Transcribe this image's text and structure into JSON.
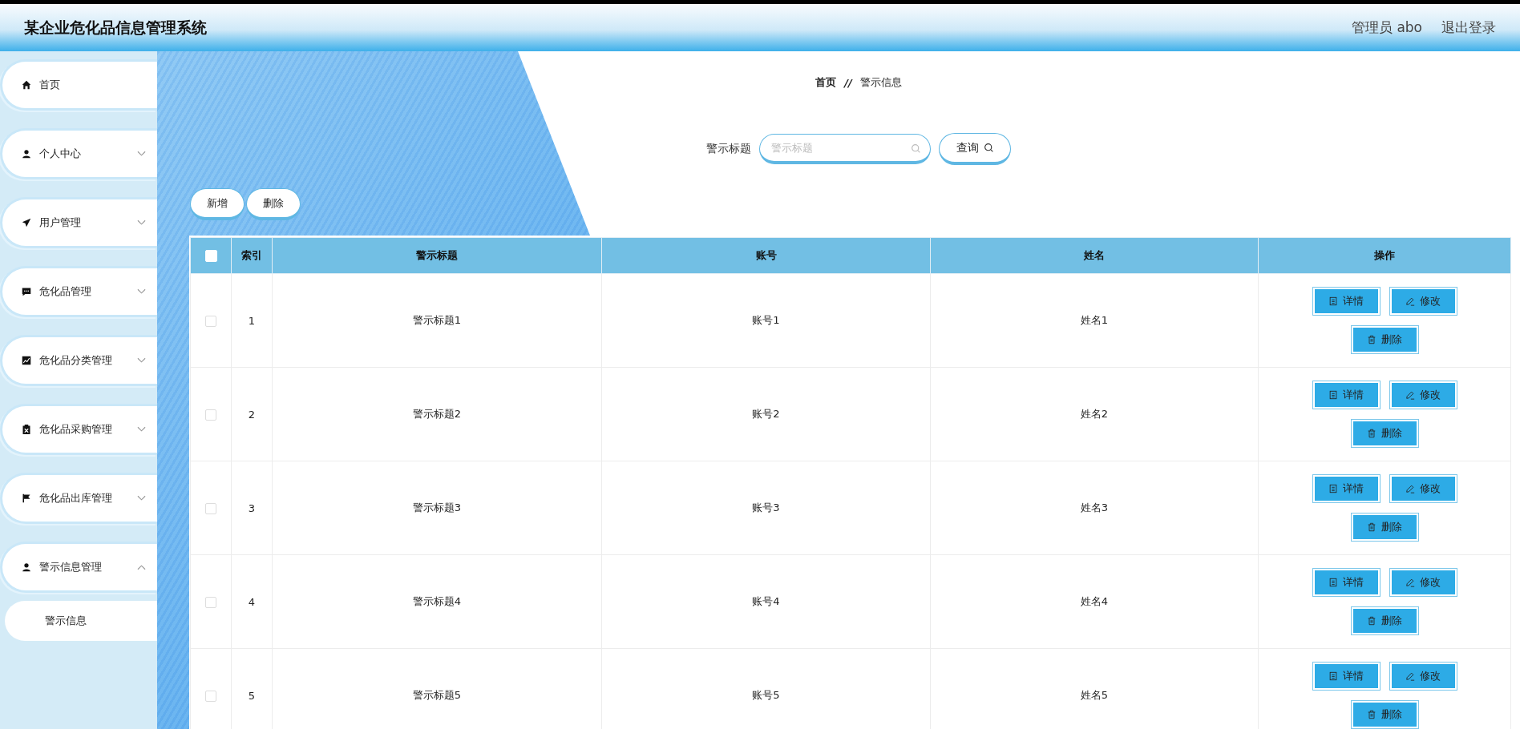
{
  "header": {
    "title": "某企业危化品信息管理系统",
    "user": "管理员 abo",
    "logout": "退出登录"
  },
  "sidebar": {
    "items": [
      {
        "label": "首页",
        "selected": false
      },
      {
        "label": "个人中心",
        "selected": false,
        "expanded": false
      },
      {
        "label": "用户管理",
        "selected": false,
        "expanded": false
      },
      {
        "label": "危化品管理",
        "selected": false,
        "expanded": false
      },
      {
        "label": "危化品分类管理",
        "selected": false,
        "expanded": false
      },
      {
        "label": "危化品采购管理",
        "selected": false,
        "expanded": false
      },
      {
        "label": "危化品出库管理",
        "selected": false,
        "expanded": false
      },
      {
        "label": "警示信息管理",
        "selected": false,
        "expanded": true,
        "children": [
          {
            "label": "警示信息",
            "selected": true
          }
        ]
      }
    ]
  },
  "breadcrumb": {
    "items": [
      "首页",
      "警示信息"
    ],
    "separator": "//"
  },
  "search": {
    "label": "警示标题",
    "placeholder": "警示标题",
    "button": "查询"
  },
  "toolbar": {
    "buttons": [
      "新增",
      "删除"
    ]
  },
  "table": {
    "select_all_checked": false,
    "columns": [
      "索引",
      "警示标题",
      "账号",
      "姓名",
      "操作"
    ],
    "rows": [
      {
        "checked": false,
        "cells": [
          "1",
          "警示标题1",
          "账号1",
          "姓名1"
        ],
        "actions": [
          "详情",
          "修改",
          "删除"
        ]
      },
      {
        "checked": false,
        "cells": [
          "2",
          "警示标题2",
          "账号2",
          "姓名2"
        ],
        "actions": [
          "详情",
          "修改",
          "删除"
        ]
      },
      {
        "checked": false,
        "cells": [
          "3",
          "警示标题3",
          "账号3",
          "姓名3"
        ],
        "actions": [
          "详情",
          "修改",
          "删除"
        ]
      },
      {
        "checked": false,
        "cells": [
          "4",
          "警示标题4",
          "账号4",
          "姓名4"
        ],
        "actions": [
          "详情",
          "修改",
          "删除"
        ]
      },
      {
        "checked": false,
        "cells": [
          "5",
          "警示标题5",
          "账号5",
          "姓名5"
        ],
        "actions": [
          "详情",
          "修改",
          "删除"
        ]
      }
    ]
  }
}
